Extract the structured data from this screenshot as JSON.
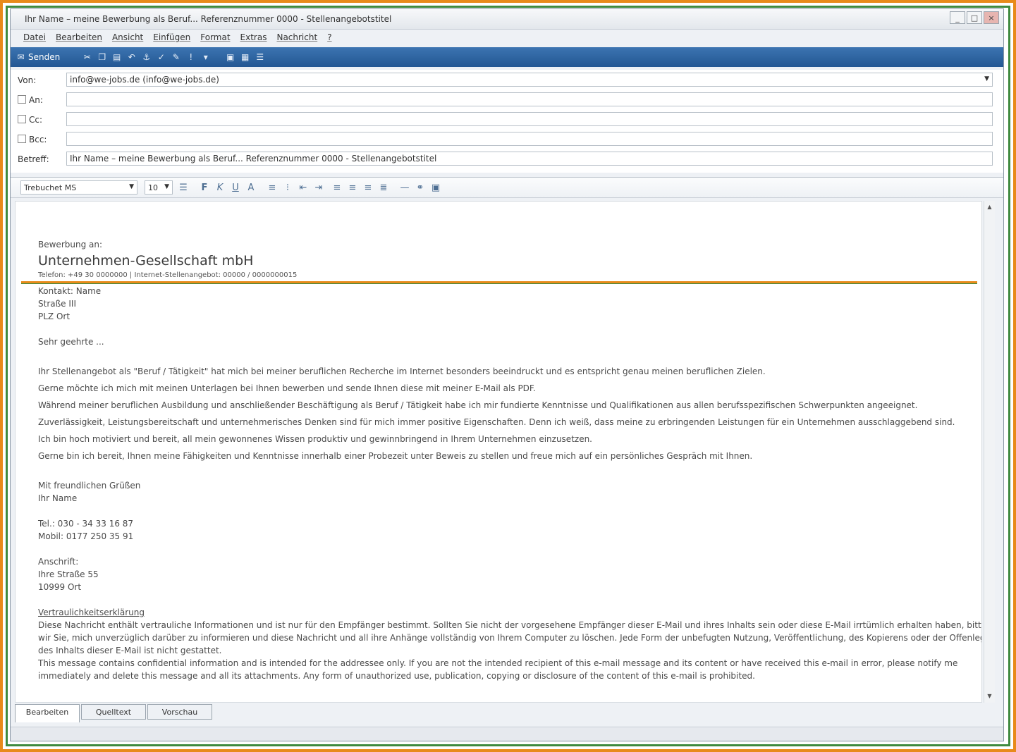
{
  "window": {
    "title": "Ihr Name – meine Bewerbung als Beruf... Referenznummer 0000 - Stellenangebotstitel",
    "controls": [
      "_",
      "□",
      "×"
    ]
  },
  "menu": [
    "Datei",
    "Bearbeiten",
    "Ansicht",
    "Einfügen",
    "Format",
    "Extras",
    "Nachricht",
    "?"
  ],
  "toolbar": {
    "send_label": "Senden"
  },
  "header": {
    "from_label": "Von:",
    "from_value": "info@we-jobs.de   (info@we-jobs.de)",
    "to_label": "An:",
    "cc_label": "Cc:",
    "bcc_label": "Bcc:",
    "subject_label": "Betreff:",
    "subject_value": "Ihr Name – meine Bewerbung als Beruf... Referenznummer 0000 - Stellenangebotstitel"
  },
  "format": {
    "font": "Trebuchet MS",
    "size": "10"
  },
  "body": {
    "intro": "Bewerbung an:",
    "company": "Unternehmen-Gesellschaft mbH",
    "company_line": "Telefon: +49 30 0000000 | Internet-Stellenangebot: 00000 / 0000000015",
    "contact": "Kontakt: Name",
    "street": "Straße III",
    "city": "PLZ Ort",
    "salutation": "Sehr geehrte ...",
    "p1": "Ihr Stellenangebot als \"Beruf / Tätigkeit\" hat mich bei meiner beruflichen Recherche im Internet besonders beeindruckt und es entspricht genau meinen beruflichen Zielen.",
    "p2": "Gerne möchte ich mich mit meinen Unterlagen bei Ihnen bewerben und sende Ihnen diese mit meiner E-Mail als PDF.",
    "p3": "Während meiner beruflichen Ausbildung und anschließender Beschäftigung als Beruf / Tätigkeit  habe ich mir fundierte Kenntnisse und Qualifikationen aus allen berufsspezifischen Schwerpunkten angeeignet.",
    "p4": "Zuverlässigkeit, Leistungsbereitschaft und unternehmerisches Denken sind für mich immer positive Eigenschaften. Denn ich weiß,  dass meine zu erbringenden Leistungen für ein Unternehmen ausschlaggebend sind.",
    "p5": "Ich bin hoch motiviert und bereit, all mein gewonnenes Wissen produktiv und gewinnbringend in Ihrem Unternehmen einzusetzen.",
    "p6": "Gerne bin ich bereit, Ihnen meine Fähigkeiten und Kenntnisse innerhalb einer Probezeit unter Beweis zu stellen und freue mich auf ein persönliches Gespräch mit Ihnen.",
    "closing": "Mit freundlichen Grüßen",
    "name": "Ihr Name",
    "tel": "Tel.: 030 - 34 33 16 87",
    "mobil": "Mobil: 0177 250 35 91",
    "address_label": "Anschrift:",
    "address_street": "Ihre Straße 55",
    "address_city": "10999 Ort",
    "disclaimer_title": "Vertraulichkeitserklärung",
    "disc1": "Diese Nachricht enthält vertrauliche Informationen und ist nur für den Empfänger bestimmt. Sollten Sie nicht der vorgesehene Empfänger dieser E-Mail und ihres Inhalts sein oder diese E-Mail irrtümlich erhalten haben, bitten",
    "disc2": "wir Sie, mich unverzüglich darüber zu informieren und diese Nachricht und all ihre Anhänge vollständig von Ihrem Computer zu löschen.  Jede Form der unbefugten Nutzung, Veröffentlichung, des Kopierens oder der Offenlegung",
    "disc3": "des Inhalts dieser E-Mail ist nicht gestattet.",
    "disc4": "This message contains confidential information and is intended for the addressee only. If you are not the intended recipient of this e-mail message and its content or have received this e-mail in error, please notify me",
    "disc5": "immediately and delete this message and all its attachments. Any form of unauthorized use, publication, copying or disclosure of the content of this e-mail is prohibited."
  },
  "tabs": [
    "Bearbeiten",
    "Quelltext",
    "Vorschau"
  ]
}
